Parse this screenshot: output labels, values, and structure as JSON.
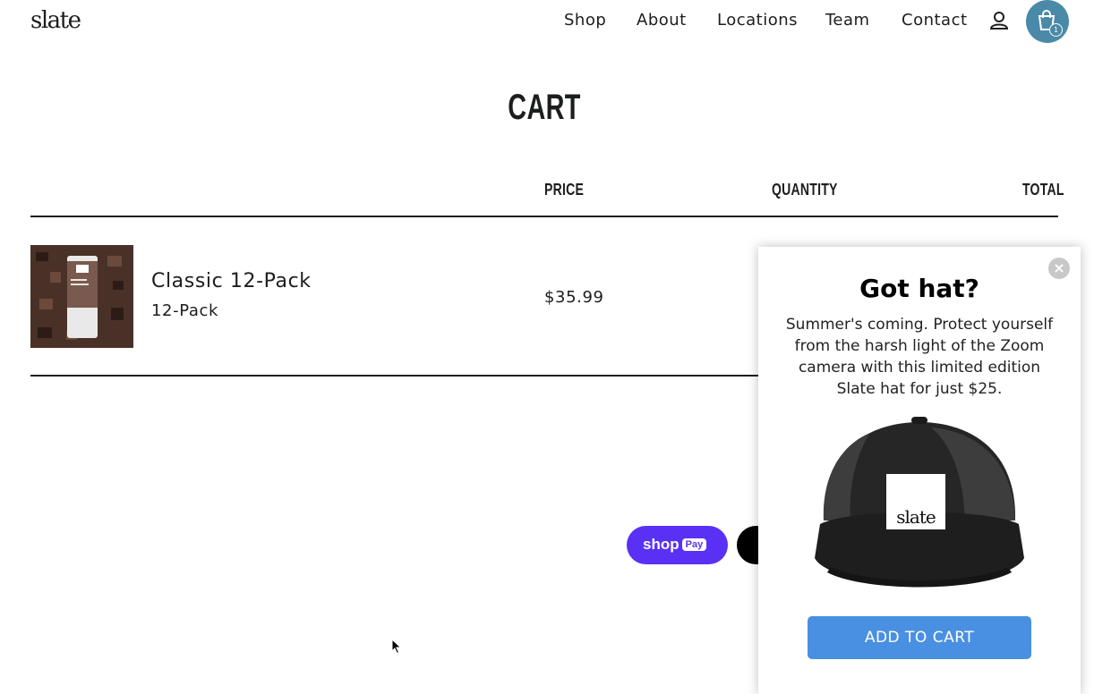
{
  "header": {
    "logo": "slate",
    "nav": [
      "Shop",
      "About",
      "Locations",
      "Team",
      "Contact"
    ],
    "account_icon": "account-icon",
    "cart_icon": "shopping-bag-icon",
    "cart_count": "1"
  },
  "cart": {
    "title": "CART",
    "columns": {
      "price": "PRICE",
      "quantity": "QUANTITY",
      "total": "TOTAL"
    },
    "items": [
      {
        "name": "Classic 12-Pack",
        "variant": "12-Pack",
        "price": "$35.99"
      }
    ]
  },
  "payment": {
    "shop_pay_label": "shop",
    "shop_pay_badge": "Pay"
  },
  "popup": {
    "title": "Got hat?",
    "body": "Summer's coming. Protect yourself from the harsh light of the Zoom camera with this limited edition Slate hat for just $25.",
    "hat_logo": "slate",
    "cta": "ADD TO CART",
    "close_symbol": "×"
  },
  "colors": {
    "cart_button": "#4a89a8",
    "shop_pay": "#5a31f4",
    "popup_cta": "#4a90e2",
    "text": "#1c1d1d"
  }
}
